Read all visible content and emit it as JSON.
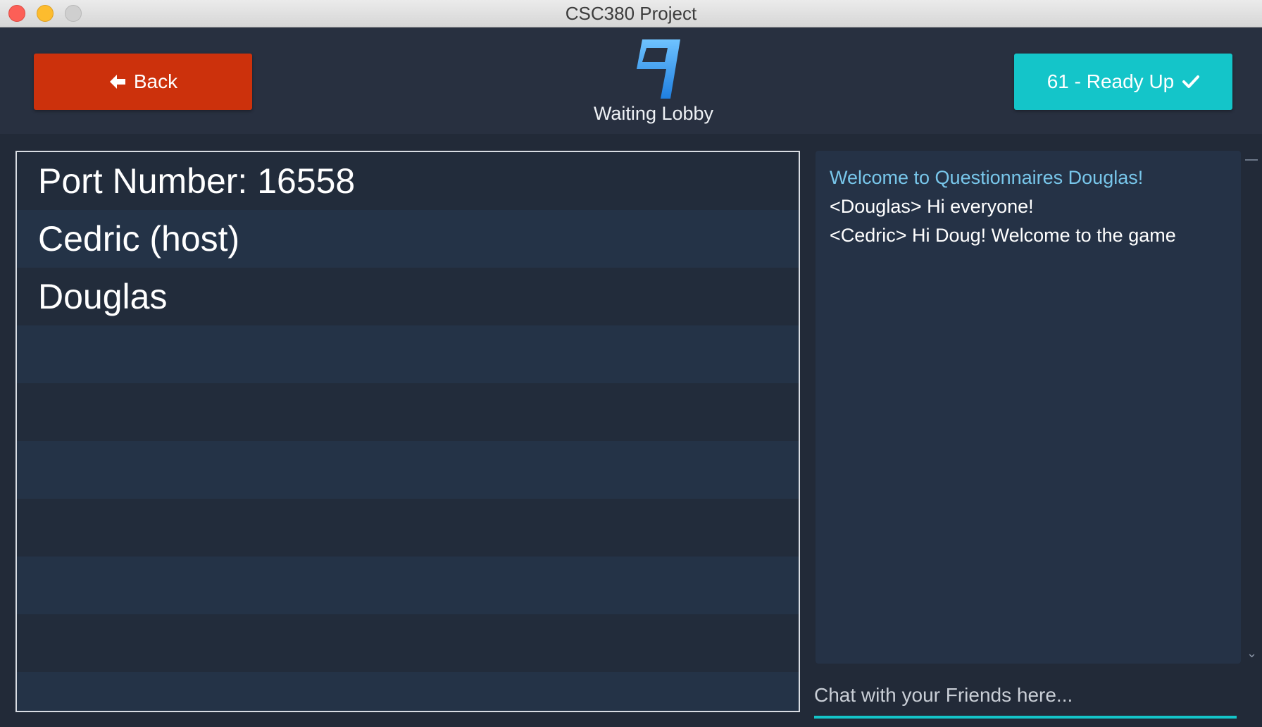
{
  "window": {
    "title": "CSC380 Project"
  },
  "header": {
    "back_label": "Back",
    "ready_label": "61 - Ready Up",
    "lobby_title": "Waiting Lobby",
    "logo_letter": "q"
  },
  "player_list": {
    "rows": [
      "Port Number: 16558",
      "Cedric (host)",
      "Douglas",
      "",
      "",
      "",
      "",
      "",
      "",
      ""
    ]
  },
  "chat": {
    "messages": [
      "Welcome to Questionnaires Douglas!",
      "<Douglas> Hi everyone!",
      "<Cedric> Hi Doug! Welcome to the game"
    ],
    "input_placeholder": "Chat with your Friends here..."
  },
  "colors": {
    "back": "#cc310c",
    "ready": "#14c5c9",
    "system_message": "#78c6ea",
    "background": "#222a38"
  }
}
